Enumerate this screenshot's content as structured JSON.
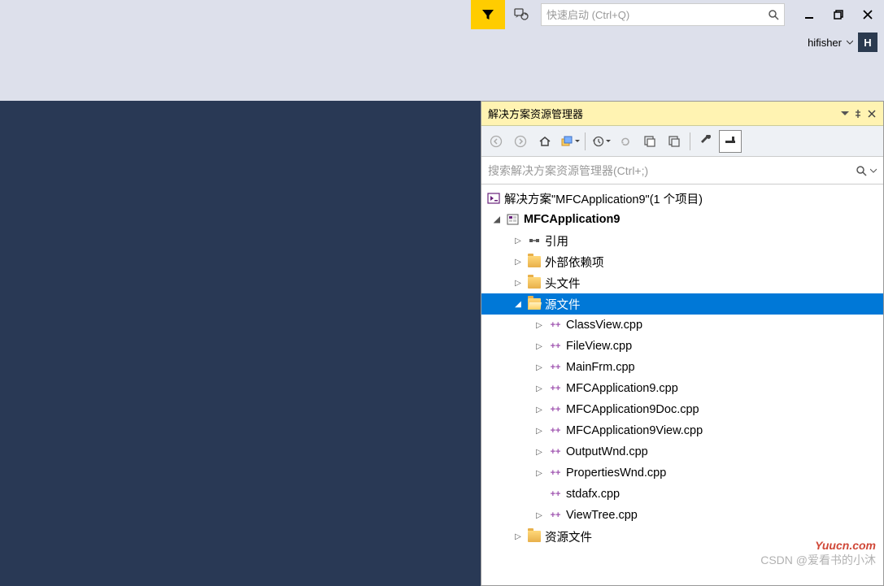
{
  "top": {
    "quick_launch_placeholder": "快速启动 (Ctrl+Q)"
  },
  "user": {
    "name": "hifisher",
    "initial": "H"
  },
  "panel": {
    "title": "解决方案资源管理器",
    "search_placeholder": "搜索解决方案资源管理器(Ctrl+;)"
  },
  "tree": {
    "solution": "解决方案\"MFCApplication9\"(1 个项目)",
    "project": "MFCApplication9",
    "references": "引用",
    "external": "外部依赖项",
    "headers": "头文件",
    "sources": "源文件",
    "resources": "资源文件",
    "cpp": [
      "ClassView.cpp",
      "FileView.cpp",
      "MainFrm.cpp",
      "MFCApplication9.cpp",
      "MFCApplication9Doc.cpp",
      "MFCApplication9View.cpp",
      "OutputWnd.cpp",
      "PropertiesWnd.cpp",
      "stdafx.cpp",
      "ViewTree.cpp"
    ]
  },
  "watermark1": "Yuucn.com",
  "watermark2": "CSDN @爱看书的小沐"
}
